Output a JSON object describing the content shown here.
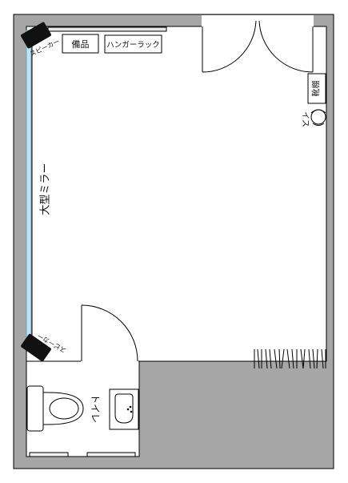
{
  "floor_plan": {
    "labels": {
      "supplies": "備品",
      "hanger_rack": "ハンガーラック",
      "speaker_top": "スピーカー",
      "speaker_bottom": "スピーカー",
      "mirror": "大型ミラー",
      "shoe_rack": "靴棚",
      "chair": "イス",
      "toilet": "トイレ"
    },
    "colors": {
      "wall": "#a6a6a6",
      "floor": "#ffffff",
      "mirror": "#bfe3f0",
      "speaker": "#111111",
      "outline": "#000000"
    },
    "icons": [
      "speaker-icon",
      "door-swing-icon",
      "chair-icon",
      "toilet-icon",
      "sink-icon"
    ]
  }
}
